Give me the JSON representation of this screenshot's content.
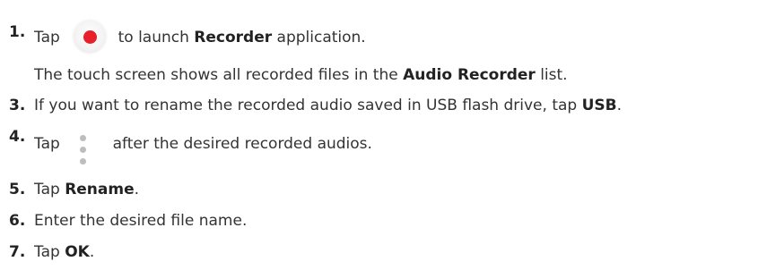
{
  "steps": [
    {
      "num": "1.",
      "pre": "Tap",
      "mid": "to launch",
      "bold": "Recorder",
      "post": "application."
    },
    {
      "sub_pre": "The touch screen shows all recorded files in the",
      "sub_bold": "Audio Recorder",
      "sub_post": "list."
    },
    {
      "num": "3.",
      "pre": "If you want to rename the recorded audio saved in USB flash drive, tap",
      "bold": "USB",
      "post": "."
    },
    {
      "num": "4.",
      "pre": "Tap",
      "post": "after the desired recorded audios."
    },
    {
      "num": "5.",
      "pre": "Tap",
      "bold": "Rename",
      "post": "."
    },
    {
      "num": "6.",
      "pre": "Enter the desired file name."
    },
    {
      "num": "7.",
      "pre": "Tap",
      "bold": "OK",
      "post": "."
    }
  ],
  "icons": {
    "recorder": "record-button-icon",
    "more": "more-options-icon"
  },
  "colors": {
    "record_red": "#e8202a",
    "dot_gray": "#bdbdbd"
  }
}
